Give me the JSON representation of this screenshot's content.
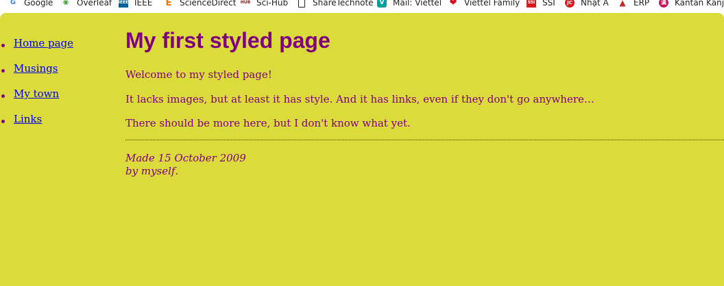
{
  "bookmarks": [
    {
      "label": "Google",
      "icon": "google-icon",
      "color": "#4285f4"
    },
    {
      "label": "Overleaf",
      "icon": "overleaf-icon",
      "color": "#47a141"
    },
    {
      "label": "IEEE",
      "icon": "ieee-icon",
      "color": "#00629b"
    },
    {
      "label": "ScienceDirect",
      "icon": "sciencedirect-icon",
      "color": "#ff6c00"
    },
    {
      "label": "Sci-Hub",
      "icon": "scihub-icon",
      "color": "#8b1a1a"
    },
    {
      "label": "ShareTechnote",
      "icon": "document-icon",
      "color": "#202124"
    },
    {
      "label": "Mail: Viettel",
      "icon": "viettel-mail-icon",
      "color": "#00a19a"
    },
    {
      "label": "Viettel Family",
      "icon": "viettel-family-icon",
      "color": "#e2001a"
    },
    {
      "label": "SSI",
      "icon": "ssi-icon",
      "color": "#d71920"
    },
    {
      "label": "Nhật A",
      "icon": "nhat-a-icon",
      "color": "#d71920"
    },
    {
      "label": "ERP",
      "icon": "erp-icon",
      "color": "#c62828"
    },
    {
      "label": "Kantan Kanji",
      "icon": "kantan-kanji-icon",
      "color": "#c2185b"
    }
  ],
  "page": {
    "background": "#dbdb3b",
    "text_color": "#800080",
    "link_color": "#0000ee"
  },
  "nav": {
    "items": [
      "Home page",
      "Musings",
      "My town",
      "Links"
    ]
  },
  "main": {
    "title": "My first styled page",
    "paragraphs": [
      "Welcome to my styled page!",
      "It lacks images, but at least it has style. And it has links, even if they don't go anywhere…",
      "There should be more here, but I don't know what yet."
    ],
    "address_line1": "Made 15 October 2009",
    "address_by": "by ",
    "address_name": "myself",
    "address_end": "."
  }
}
